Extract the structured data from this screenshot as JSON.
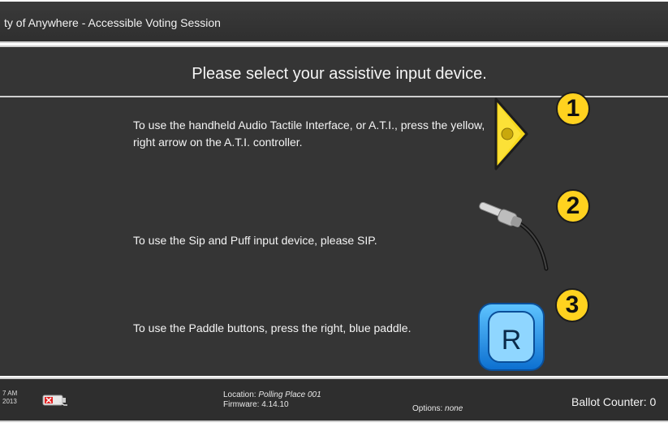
{
  "title_bar": {
    "text": "ty of Anywhere - Accessible Voting Session"
  },
  "header": {
    "prompt": "Please select your assistive input device."
  },
  "options": [
    {
      "number": "1",
      "text": "To use the handheld Audio Tactile Interface, or A.T.I., press the yellow, right arrow on the A.T.I. controller.",
      "icon": "yellow-right-arrow-icon"
    },
    {
      "number": "2",
      "text": "To use the Sip and Puff input device, please SIP.",
      "icon": "sip-puff-straw-icon"
    },
    {
      "number": "3",
      "text": "To use the Paddle buttons, press the right, blue paddle.",
      "icon": "blue-paddle-icon",
      "paddle_letter": "R"
    }
  ],
  "footer": {
    "time": "7 AM",
    "date": "2013",
    "location_label": "Location:",
    "location": "Polling Place 001",
    "firmware_label": "Firmware:",
    "firmware": "4.14.10",
    "options_label": "Options:",
    "options_value": "none",
    "ballot_counter": "Ballot Counter: 0"
  },
  "colors": {
    "background": "#353535",
    "badge": "#ffd21f",
    "ati_arrow": "#f7d81c",
    "paddle_blue": "#1f8fe6"
  }
}
